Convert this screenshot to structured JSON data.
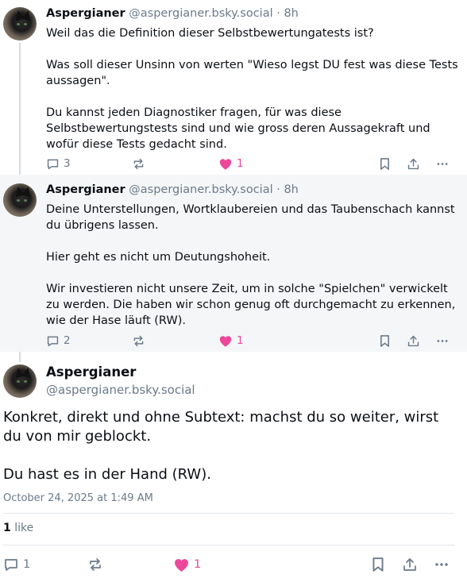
{
  "posts": [
    {
      "name": "Aspergianer",
      "handle": "@aspergianer.bsky.social",
      "time": "· 8h",
      "paragraphs": [
        "Weil das die Definition dieser Selbstbewertungatests ist?",
        "Was soll dieser Unsinn von werten \"Wieso legst DU fest was diese Tests aussagen\".",
        "Du kannst jeden Diagnostiker fragen, für was diese Selbstbewertungstests sind und wie gross deren Aussagekraft und wofür diese Tests gedacht sind."
      ],
      "replies": "3",
      "likes": "1"
    },
    {
      "name": "Aspergianer",
      "handle": "@aspergianer.bsky.social",
      "time": "· 8h",
      "paragraphs": [
        "Deine Unterstellungen, Wortklaubereien und das Taubenschach kannst du übrigens lassen.",
        "Hier geht es nicht um Deutungshoheit.",
        "Wir investieren nicht unsere Zeit, um in solche \"Spielchen\" verwickelt zu werden. Die haben wir schon genug oft durchgemacht zu erkennen, wie der Hase läuft (RW)."
      ],
      "replies": "2",
      "likes": "1"
    }
  ],
  "main_post": {
    "name": "Aspergianer",
    "handle": "@aspergianer.bsky.social",
    "paragraphs": [
      "Konkret, direkt und ohne Subtext: machst du so weiter, wirst du von mir geblockt.",
      "Du hast es in der Hand (RW)."
    ],
    "date": "October 24, 2025 at 1:49 AM",
    "like_count": "1",
    "like_label": "like",
    "replies": "1",
    "likes": "1"
  },
  "colors": {
    "accent_like": "#ec4899",
    "muted": "#6b7a8a",
    "alt_background": "#f5f6f8"
  },
  "icons": [
    "reply-icon",
    "repost-icon",
    "heart-icon",
    "bookmark-icon",
    "share-icon",
    "more-icon"
  ]
}
